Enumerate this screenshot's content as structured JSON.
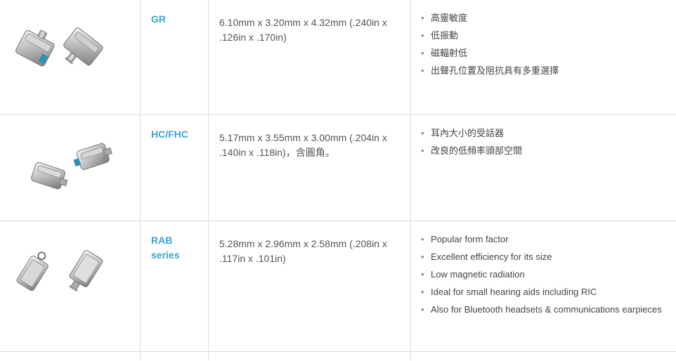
{
  "bullet": "•",
  "rows": [
    {
      "name": "GR",
      "dimensions": "6.10mm x 3.20mm x 4.32mm (.240in x .126in x .170in)",
      "features": [
        "高靈敏度",
        "低振動",
        "磁輻射低",
        "出聲孔位置及阻抗具有多重選擇"
      ]
    },
    {
      "name": "HC/FHC",
      "dimensions": "5.17mm x 3.55mm x 3.00mm (.204in x .140in x .118in)，含圓角。",
      "features": [
        "耳內大小的受話器",
        "改良的低頻率頭部空間"
      ]
    },
    {
      "name": "RAB series",
      "dimensions": "5.28mm x 2.96mm x 2.58mm (.208in x .117in x .101in)",
      "features": [
        "Popular form factor",
        "Excellent efficiency for its size",
        "Low magnetic radiation",
        "Ideal for small hearing aids including RIC",
        "Also for Bluetooth headsets & communications earpieces"
      ]
    }
  ],
  "colors": {
    "model_name": "#3aa4cf",
    "border": "#dcdcdc",
    "text": "#555555"
  }
}
